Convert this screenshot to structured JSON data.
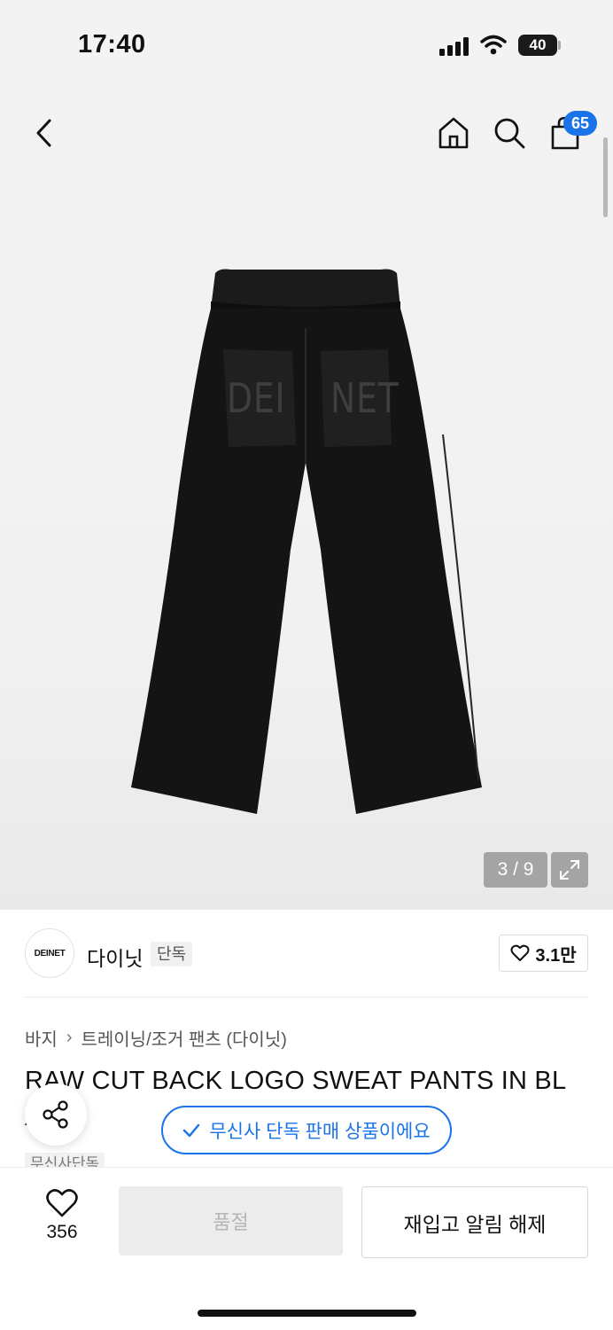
{
  "status_bar": {
    "time": "17:40",
    "battery": "40"
  },
  "header": {
    "cart_count": "65"
  },
  "gallery": {
    "counter": "3 / 9",
    "print_left": "DEI",
    "print_right": "NET"
  },
  "brand": {
    "logo_text": "DEINET",
    "name": "다이닛",
    "tag": "단독",
    "likes": "3.1만"
  },
  "breadcrumb": {
    "category": "바지",
    "subcategory": "트레이닝/조거 팬츠 (다이닛)"
  },
  "product": {
    "title": "RAW CUT BACK LOGO SWEAT PANTS IN BL",
    "title_line2": "A",
    "tag": "무신사단독"
  },
  "toast": {
    "text": "무신사 단독 판매 상품이에요"
  },
  "bottom": {
    "wish_count": "356",
    "soldout_label": "품절",
    "restock_label": "재입고 알림 해제"
  },
  "colors": {
    "accent": "#1a73e8",
    "text": "#111111",
    "muted": "#555555"
  }
}
